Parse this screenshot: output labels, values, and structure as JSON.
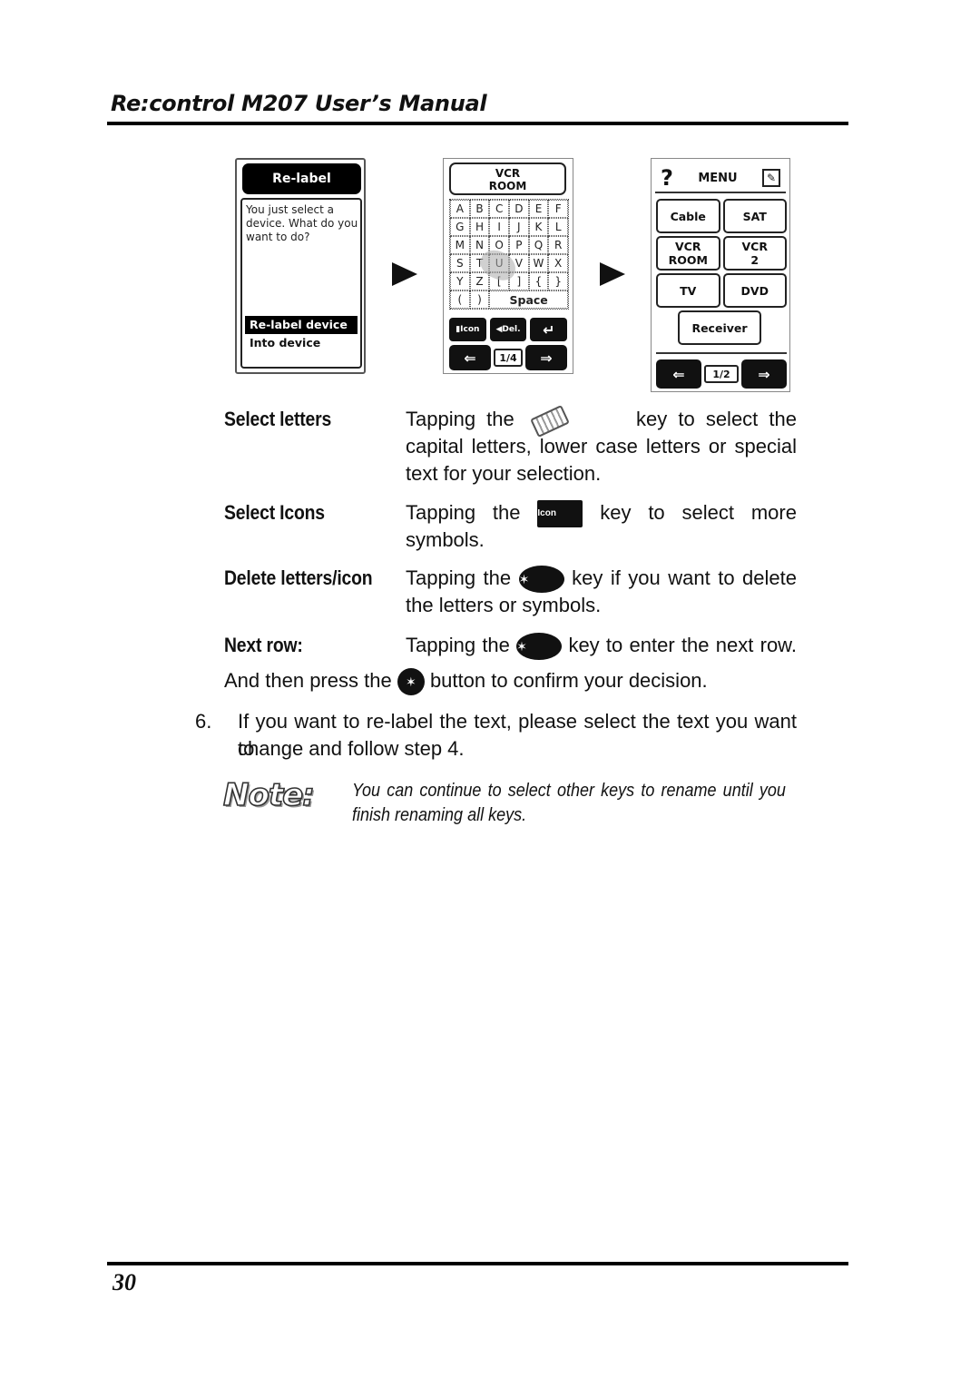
{
  "header": {
    "title": "Re:control M207 User’s Manual"
  },
  "figures": {
    "relabel_screen": {
      "title": "Re-label",
      "message": "You just select a device. What do you want to do?",
      "options": [
        "Re-label device",
        "Into device"
      ]
    },
    "keyboard_screen": {
      "title_line1": "VCR",
      "title_line2": "ROOM",
      "keys": [
        "A",
        "B",
        "C",
        "D",
        "E",
        "F",
        "G",
        "H",
        "I",
        "J",
        "K",
        "L",
        "M",
        "N",
        "O",
        "P",
        "Q",
        "R",
        "S",
        "T",
        "U",
        "V",
        "W",
        "X",
        "Y",
        "Z",
        "[",
        "]",
        "{",
        "}",
        "(",
        ")"
      ],
      "space_label": "Space",
      "icon_key": "Icon",
      "delete_key": "Del.",
      "enter_key": "↵",
      "prev_icon": "prev-page-icon",
      "next_icon": "next-page-icon",
      "page": "1/4"
    },
    "menu_screen": {
      "help_glyph": "?",
      "menu_label": "MENU",
      "edit_glyph": "✎",
      "devices": [
        {
          "line1": "Cable",
          "line2": ""
        },
        {
          "line1": "SAT",
          "line2": ""
        },
        {
          "line1": "VCR",
          "line2": "ROOM"
        },
        {
          "line1": "VCR",
          "line2": "2"
        },
        {
          "line1": "TV",
          "line2": ""
        },
        {
          "line1": "DVD",
          "line2": ""
        },
        {
          "line1": "Receiver",
          "line2": ""
        }
      ],
      "page": "1/2"
    }
  },
  "instructions": [
    {
      "label": "Select letters",
      "before": "Tapping the",
      "icon": "remote-keypad-icon",
      "after": "key to select the capital letters, lower case letters or special text for your selection."
    },
    {
      "label": "Select Icons",
      "before": "Tapping the",
      "icon": "icon-key-icon",
      "icon_text": "Icon",
      "after": "key to select more symbols."
    },
    {
      "label": "Delete letters/icon",
      "before": "Tapping the",
      "icon": "delete-key-icon",
      "after": "key if you want to delete the letters or symbols."
    },
    {
      "label": "Next row:",
      "before": "Tapping the",
      "icon": "enter-key-icon",
      "after": "key to enter the next row."
    }
  ],
  "confirm_line": {
    "before": "And then press the",
    "icon": "ok-button-icon",
    "after": "button to confirm your decision."
  },
  "step6": {
    "number": "6.",
    "text_line1": "If you want to re-label the text, please select the text you want to",
    "text_line2": "change and follow step 4."
  },
  "note": {
    "label": "Note:",
    "text": "You can continue to select other keys to rename until you finish renaming all keys."
  },
  "footer": {
    "page_number": "30"
  }
}
